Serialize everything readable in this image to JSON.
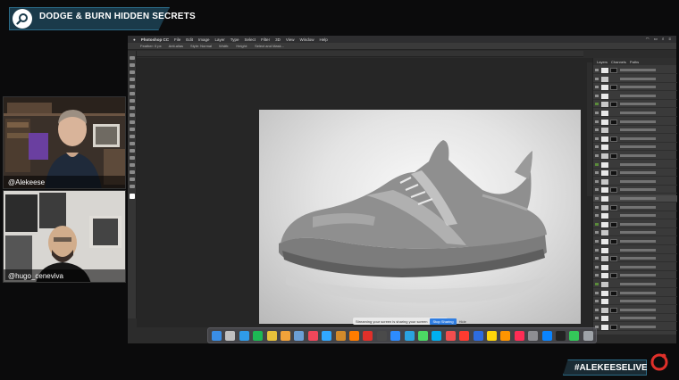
{
  "broadcast": {
    "title": "DODGE & BURN HIDDEN SECRETS",
    "hashtag": "#ALEKEESELIVE",
    "accent_color": "#e0302a",
    "banner_color": "#2b6a86",
    "logo_icon": "magnifier-icon"
  },
  "webcams": [
    {
      "label": "@Alekeese"
    },
    {
      "label": "@hugo_ceneviva"
    }
  ],
  "mac_menu": {
    "app": "Photoshop CC",
    "items": [
      "File",
      "Edit",
      "Image",
      "Layer",
      "Type",
      "Select",
      "Filter",
      "3D",
      "View",
      "Window",
      "Help"
    ],
    "status_icons": [
      "wifi-icon",
      "battery-icon",
      "search-icon",
      "control-center-icon"
    ]
  },
  "ps_options_bar": {
    "items": [
      "Feather: 0 px",
      "Anti-alias",
      "Style: Normal",
      "Width:",
      "Height:",
      "Select and Mask..."
    ]
  },
  "layers_panel": {
    "tabs": [
      "Layers",
      "Channels",
      "Paths"
    ],
    "row_count": 31
  },
  "screen_share": {
    "message": "Streaming your screen is sharing your screen",
    "stop_label": "Stop Sharing",
    "hide_label": "Hide"
  },
  "dock": {
    "apps": [
      "finder-icon",
      "launchpad-icon",
      "safari-icon",
      "spotify-icon",
      "chrome-icon",
      "photos-icon",
      "preview-icon",
      "music-icon",
      "photoshop-icon",
      "bridge-icon",
      "illustrator-icon",
      "acrobat-icon",
      "quicktime-icon",
      "zoom-icon",
      "telegram-icon",
      "messages-icon",
      "skype-icon",
      "calendar-icon",
      "news-icon",
      "box-icon",
      "notes-icon",
      "calendar2-icon",
      "itunes-icon",
      "system-prefs-icon",
      "app-store-icon",
      "terminal-icon",
      "activity-icon",
      "trash-icon"
    ]
  }
}
